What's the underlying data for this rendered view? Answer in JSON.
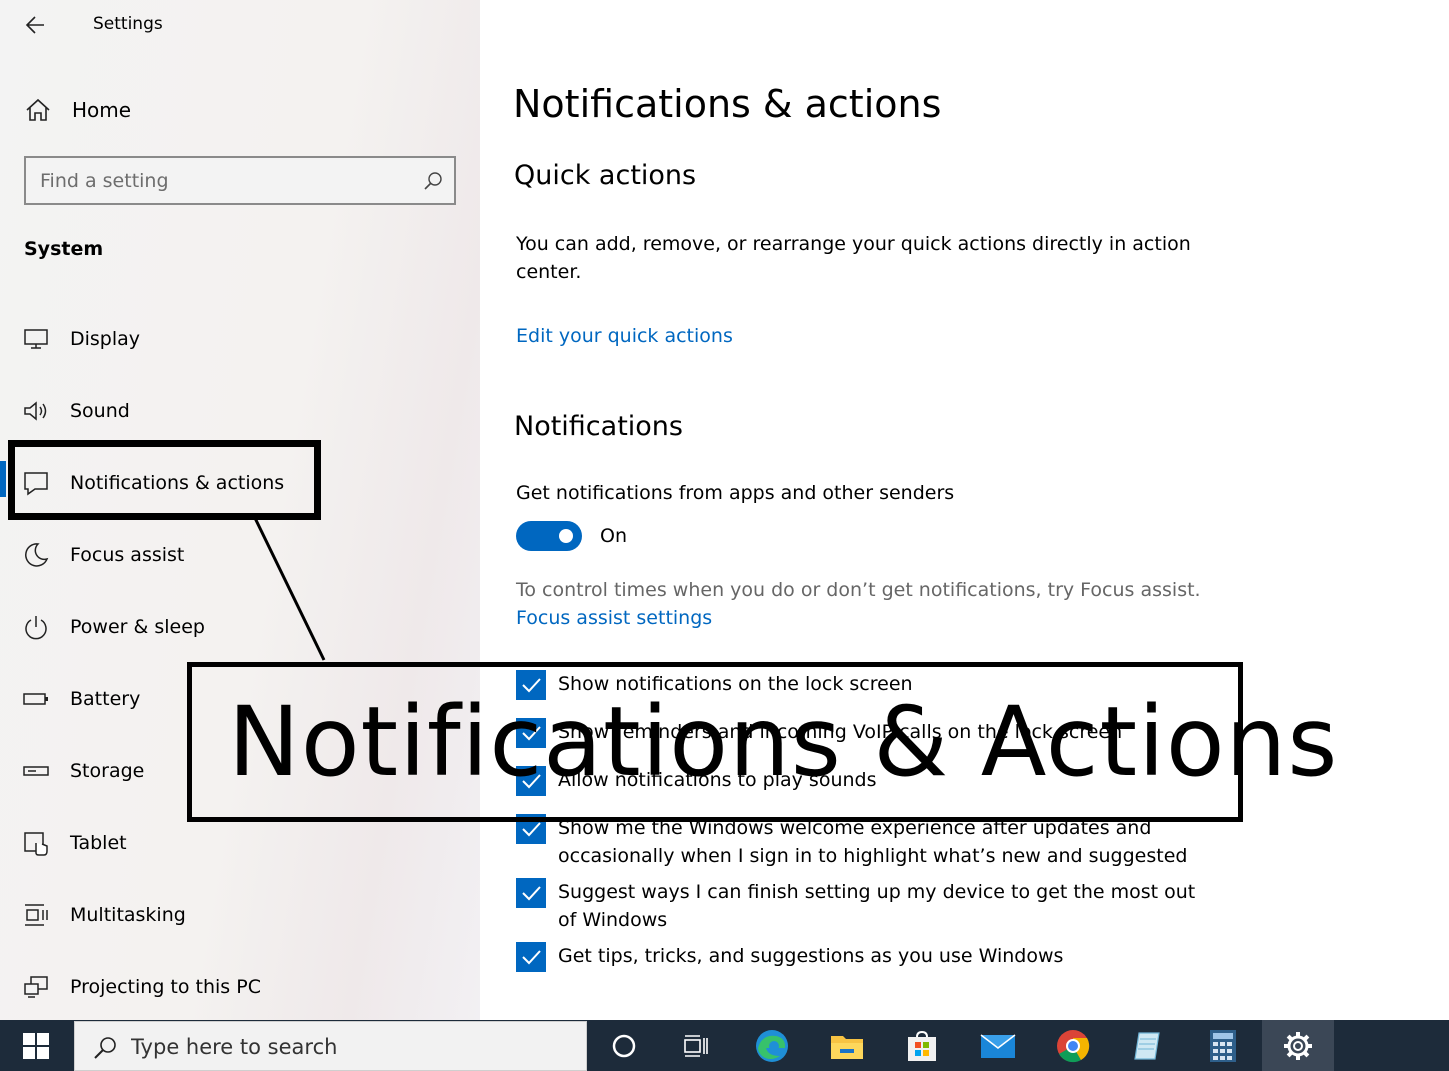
{
  "app": {
    "title": "Settings"
  },
  "sidebar": {
    "home_label": "Home",
    "search_placeholder": "Find a setting",
    "section_label": "System",
    "items": [
      {
        "label": "Display",
        "icon": "display-icon"
      },
      {
        "label": "Sound",
        "icon": "sound-icon"
      },
      {
        "label": "Notifications & actions",
        "icon": "notifications-icon",
        "selected": true
      },
      {
        "label": "Focus assist",
        "icon": "focus-assist-icon"
      },
      {
        "label": "Power & sleep",
        "icon": "power-icon"
      },
      {
        "label": "Battery",
        "icon": "battery-icon"
      },
      {
        "label": "Storage",
        "icon": "storage-icon"
      },
      {
        "label": "Tablet",
        "icon": "tablet-icon"
      },
      {
        "label": "Multitasking",
        "icon": "multitasking-icon"
      },
      {
        "label": "Projecting to this PC",
        "icon": "projecting-icon"
      }
    ]
  },
  "main": {
    "title": "Notifications & actions",
    "quick_actions": {
      "heading": "Quick actions",
      "description": "You can add, remove, or rearrange your quick actions directly in action center.",
      "link": "Edit your quick actions"
    },
    "notifications": {
      "heading": "Notifications",
      "toggle_label": "Get notifications from apps and other senders",
      "toggle_on": true,
      "toggle_state": "On",
      "focus_text": "To control times when you do or don’t get notifications, try Focus assist.",
      "focus_link": "Focus assist settings",
      "checkboxes": [
        {
          "label": "Show notifications on the lock screen",
          "checked": true
        },
        {
          "label": "Show reminders and incoming VoIP calls on the lock screen",
          "checked": true
        },
        {
          "label": "Allow notifications to play sounds",
          "checked": true
        },
        {
          "label": "Show me the Windows welcome experience after updates and occasionally when I sign in to highlight what’s new and suggested",
          "checked": true
        },
        {
          "label": "Suggest ways I can finish setting up my device to get the most out of Windows",
          "checked": true
        },
        {
          "label": "Get tips, tricks, and suggestions as you use Windows",
          "checked": true
        }
      ]
    }
  },
  "overlay": {
    "caption": "Notifications & Actions"
  },
  "taskbar": {
    "search_placeholder": "Type here to search",
    "apps": [
      "cortana-icon",
      "task-view-icon",
      "edge-icon",
      "file-explorer-icon",
      "store-icon",
      "mail-icon",
      "chrome-icon",
      "notepad-icon",
      "calculator-icon",
      "settings-icon"
    ],
    "active_app": "settings-icon"
  },
  "colors": {
    "accent": "#0067c0",
    "taskbar": "#1d2b3a",
    "sidebar": "#f3f3f3"
  }
}
